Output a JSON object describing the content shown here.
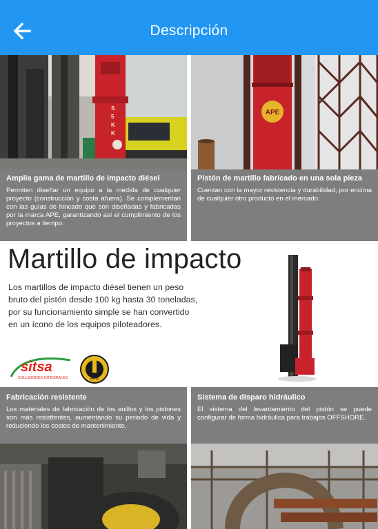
{
  "header": {
    "title": "Descripción",
    "back_icon": "arrow-back-icon",
    "background": "#2196f3"
  },
  "cards_top": [
    {
      "title": "Amplia gama de martillo de impacto diésel",
      "text": "Permiten diseñar un equipo a la medida de cualquier proyecto (construcción y costa afuera). Se complementan con las guías de hincado que son diseñadas y fabricadas por la marca APE, garantizando así el cumplimiento de los proyectos a tiempo."
    },
    {
      "title": "Pistón de martillo fabricado en una sola pieza",
      "text": "Cuentan con la mayor resistencia y durabilidad, por encima de cualquier otro producto en el mercado.",
      "photo_label": "APE"
    }
  ],
  "main": {
    "title": "Martillo de impacto",
    "description": "Los martillos de impacto diésel tienen un peso bruto del pistón desde 100 kg hasta 30 toneladas, por su funcionamiento simple se han convertido en un ícono de los equipos piloteadores.",
    "logo_sitsa": "sitsa",
    "logo_sitsa_sub": "SOLUCIONES INTEGRALES",
    "logo_ape": "APE"
  },
  "cards_bottom": [
    {
      "title": "Fabricación resistente",
      "text": "Los materiales de fabricación de los anillos y los pistones son más resisttentes, aumentando su periodo de vida y reduciendo los costos de mantenimiento."
    },
    {
      "title": "Sistema de disparo hidráulico",
      "text": "El sistema del levantamiento del pistón se puede configurar de forma hidráulica para trabajos OFFSHORE."
    }
  ],
  "colors": {
    "card_bg": "#7e7e7e",
    "hammer_red": "#c8232a",
    "sitsa_red": "#e2231a",
    "sitsa_green": "#2e9b3e"
  }
}
